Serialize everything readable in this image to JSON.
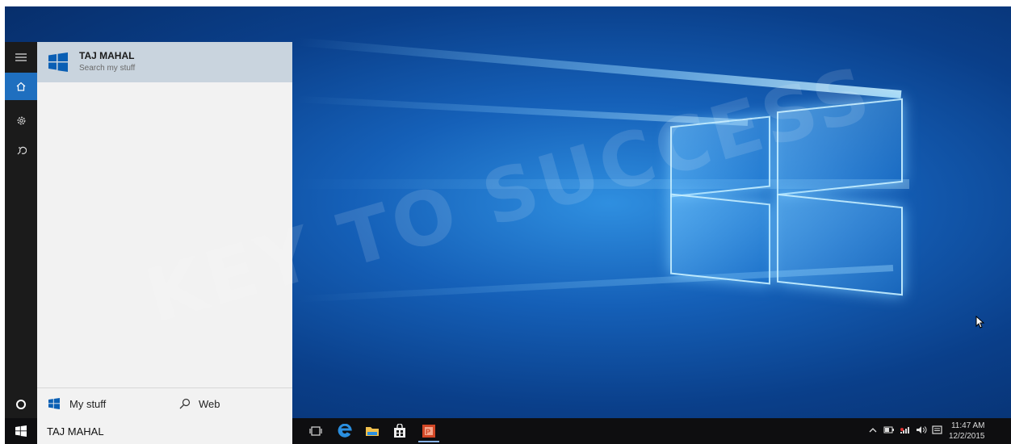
{
  "search": {
    "query": "TAJ MAHAL",
    "result_title": "TAJ MAHAL",
    "result_subtitle": "Search my stuff",
    "scope_mystuff": "My stuff",
    "scope_web": "Web"
  },
  "watermark": {
    "text": "KEY TO SUCCESS"
  },
  "tray": {
    "time": "11:47 AM",
    "date": "12/2/2015"
  },
  "icons": {
    "rail": [
      "hamburger-icon",
      "home-icon",
      "settings-icon",
      "feedback-icon",
      "cortana-circle-icon"
    ],
    "taskbar": [
      "windows-start-icon",
      "task-view-icon",
      "edge-icon",
      "file-explorer-icon",
      "store-icon",
      "powerpoint-icon"
    ],
    "tray": [
      "chevron-up-icon",
      "battery-icon",
      "network-icon",
      "volume-icon",
      "action-center-icon"
    ]
  },
  "colors": {
    "accent": "#0078d7",
    "taskbar": "#0e0e10",
    "panel": "#f2f2f2",
    "result_highlight": "#c9d4de"
  }
}
